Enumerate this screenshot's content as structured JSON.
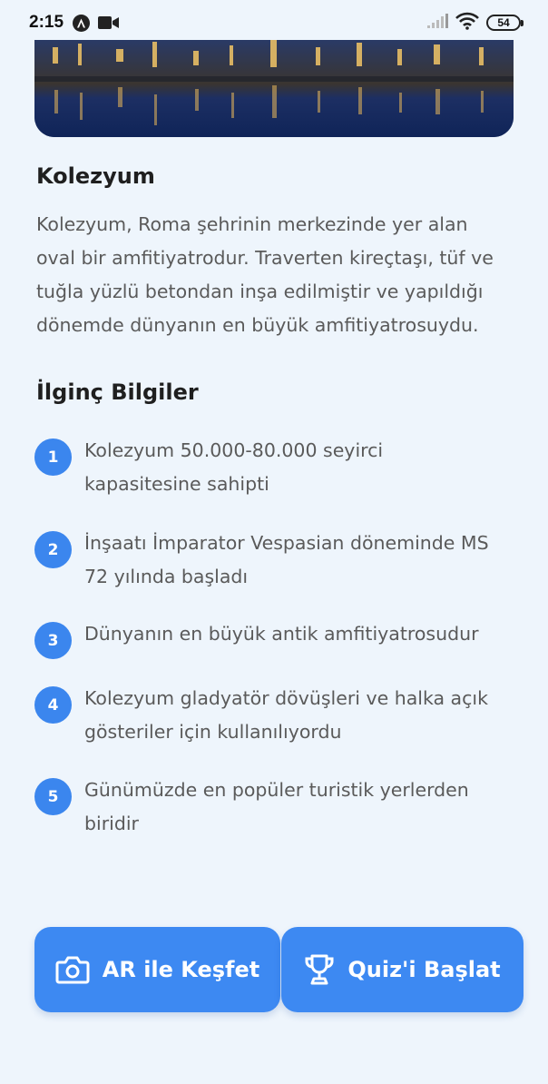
{
  "status_bar": {
    "time": "2:15",
    "battery": "54",
    "icons": [
      "a-notification-icon",
      "video-camera-icon",
      "signal-icon",
      "wifi-icon",
      "battery-icon"
    ]
  },
  "hero": {
    "image": "colosseum-night-photo"
  },
  "place": {
    "title": "Kolezyum",
    "description_lines": [
      "Kolezyum, Roma şehrinin merkezinde yer alan",
      "oval bir amfitiyatrodur. Traverten kireçtaşı, tüf ve",
      "tuğla yüzlü betondan inşa edilmiştir ve yapıldığı",
      "dönemde dünyanın en büyük amfitiyatrosuydu."
    ]
  },
  "facts": {
    "heading": "İlginç Bilgiler",
    "items": [
      {
        "num": "1",
        "lines": [
          "Kolezyum 50.000-80.000 seyirci",
          "kapasitesine sahipti"
        ]
      },
      {
        "num": "2",
        "lines": [
          "İnşaatı İmparator Vespasian döneminde MS",
          "72 yılında başladı"
        ]
      },
      {
        "num": "3",
        "lines": [
          "Dünyanın en büyük antik amfitiyatrosudur"
        ]
      },
      {
        "num": "4",
        "lines": [
          "Kolezyum gladyatör dövüşleri ve halka açık",
          "gösteriler için kullanılıyordu"
        ]
      },
      {
        "num": "5",
        "lines": [
          "Günümüzde en popüler turistik yerlerden",
          "biridir"
        ]
      }
    ]
  },
  "actions": {
    "ar_label": "AR ile Keşfet",
    "quiz_label": "Quiz'i Başlat"
  },
  "colors": {
    "accent": "#3d89f2",
    "background": "#eef5fc",
    "text_primary": "#1f1f1f",
    "text_secondary": "#5a5a5a"
  }
}
